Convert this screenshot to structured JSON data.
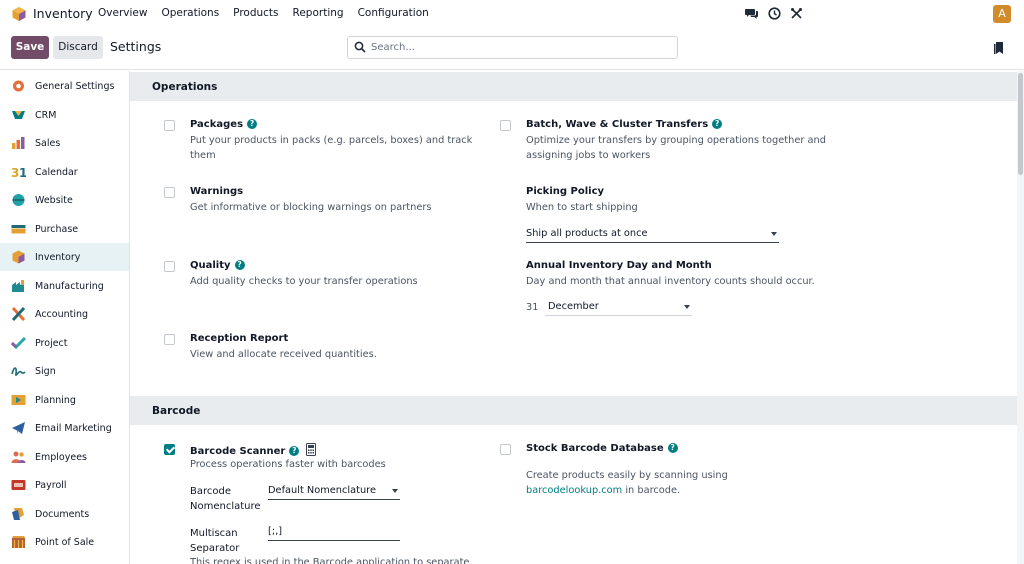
{
  "topbar": {
    "app_name": "Inventory",
    "menu": [
      "Overview",
      "Operations",
      "Products",
      "Reporting",
      "Configuration"
    ],
    "avatar": "A"
  },
  "control": {
    "save": "Save",
    "discard": "Discard",
    "title": "Settings",
    "search_placeholder": "Search..."
  },
  "sidebar": {
    "items": [
      {
        "label": "General Settings",
        "icon": "general-settings-icon",
        "color": "#e46f38"
      },
      {
        "label": "CRM",
        "icon": "crm-icon",
        "color": "#017e84"
      },
      {
        "label": "Sales",
        "icon": "sales-icon",
        "color": "#e46f38"
      },
      {
        "label": "Calendar",
        "icon": "calendar-icon",
        "color": "#d9a62a"
      },
      {
        "label": "Website",
        "icon": "website-icon",
        "color": "#1ea2a8"
      },
      {
        "label": "Purchase",
        "icon": "purchase-icon",
        "color": "#1f6b78"
      },
      {
        "label": "Inventory",
        "icon": "inventory-icon",
        "color": "#8e5aa0"
      },
      {
        "label": "Manufacturing",
        "icon": "manufacturing-icon",
        "color": "#1f8a8f"
      },
      {
        "label": "Accounting",
        "icon": "accounting-icon",
        "color": "#e46f38"
      },
      {
        "label": "Project",
        "icon": "project-icon",
        "color": "#2aa6a8"
      },
      {
        "label": "Sign",
        "icon": "sign-icon",
        "color": "#1f6b78"
      },
      {
        "label": "Planning",
        "icon": "planning-icon",
        "color": "#e4a034"
      },
      {
        "label": "Email Marketing",
        "icon": "email-marketing-icon",
        "color": "#2f5f9c"
      },
      {
        "label": "Employees",
        "icon": "employees-icon",
        "color": "#d86b52"
      },
      {
        "label": "Payroll",
        "icon": "payroll-icon",
        "color": "#c0392b"
      },
      {
        "label": "Documents",
        "icon": "documents-icon",
        "color": "#e4a034"
      },
      {
        "label": "Point of Sale",
        "icon": "point-of-sale-icon",
        "color": "#b0623c"
      }
    ],
    "active_index": 6
  },
  "operations": {
    "header": "Operations",
    "packages": {
      "title": "Packages",
      "desc": "Put your products in packs (e.g. parcels, boxes) and track them"
    },
    "batch": {
      "title": "Batch, Wave & Cluster Transfers",
      "desc": "Optimize your transfers by grouping operations together and assigning jobs to workers"
    },
    "warnings": {
      "title": "Warnings",
      "desc": "Get informative or blocking warnings on partners"
    },
    "picking": {
      "title": "Picking Policy",
      "desc": "When to start shipping",
      "value": "Ship all products at once"
    },
    "quality": {
      "title": "Quality",
      "desc": "Add quality checks to your transfer operations"
    },
    "annual": {
      "title": "Annual Inventory Day and Month",
      "desc": "Day and month that annual inventory counts should occur.",
      "day": "31",
      "month": "December"
    },
    "reception": {
      "title": "Reception Report",
      "desc": "View and allocate received quantities."
    }
  },
  "barcode": {
    "header": "Barcode",
    "scanner": {
      "title": "Barcode Scanner",
      "desc": "Process operations faster with barcodes",
      "checked": true
    },
    "nomenclature_label": "Barcode Nomenclature",
    "nomenclature_value": "Default Nomenclature",
    "multiscan_label": "Multiscan Separator",
    "multiscan_value": "[;,]",
    "regex_desc": "This regex is used in the Barcode application to separate",
    "stockdb": {
      "title": "Stock Barcode Database",
      "desc_pre": "Create products easily by scanning using ",
      "link": "barcodelookup.com",
      "desc_post": " in barcode."
    }
  }
}
